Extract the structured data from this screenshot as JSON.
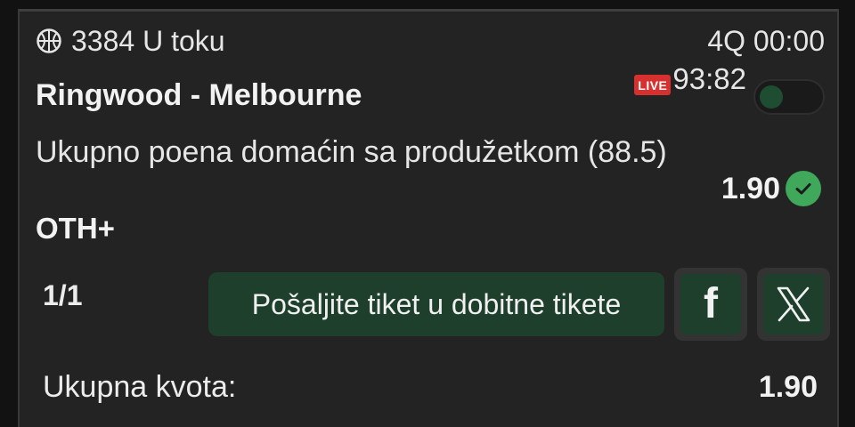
{
  "event": {
    "match_id_status": "3384 U toku",
    "period_clock": "4Q 00:00",
    "teams": "Ringwood - Melbourne",
    "live_label": "LIVE",
    "score": "93:82"
  },
  "bet": {
    "market": "Ukupno poena domaćin sa produžetkom (88.5)",
    "outcome": "OTH+",
    "odd": "1.90"
  },
  "actions": {
    "pagination": "1/1",
    "send_label": "Pošaljite tiket u dobitne tikete",
    "facebook_glyph": "f"
  },
  "summary": {
    "total_odds_label": "Ukupna kvota:",
    "total_odds_value": "1.90"
  },
  "colors": {
    "accent_green": "#1d3f2c",
    "check_green": "#3fa85a",
    "live_red": "#d6302f"
  },
  "icons": [
    "basketball-icon",
    "checkmark-icon",
    "facebook-icon",
    "x-icon"
  ]
}
